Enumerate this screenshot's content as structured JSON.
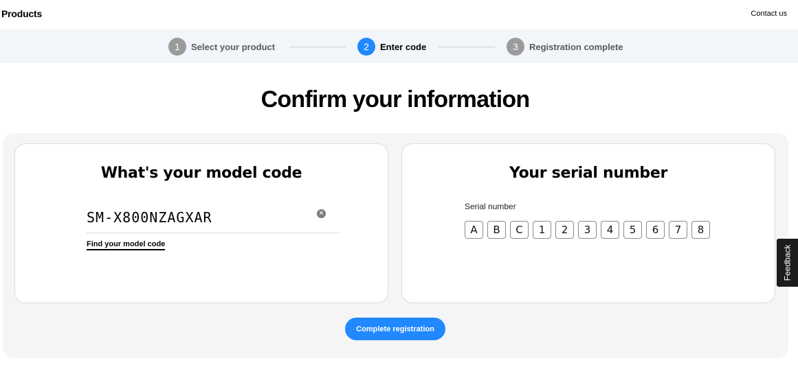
{
  "header": {
    "brand": "Products",
    "contact": "Contact us"
  },
  "stepper": {
    "steps": [
      {
        "number": "1",
        "label": "Select your product",
        "state": "done"
      },
      {
        "number": "2",
        "label": "Enter code",
        "state": "active"
      },
      {
        "number": "3",
        "label": "Registration complete",
        "state": "pending"
      }
    ]
  },
  "page": {
    "title": "Confirm your information"
  },
  "model_card": {
    "title": "What's your model code",
    "value": "SM-X800NZAGXAR",
    "clear_icon": "clear-icon",
    "find_link": "Find your model code"
  },
  "serial_card": {
    "title": "Your serial number",
    "label": "Serial number",
    "chars": [
      "A",
      "B",
      "C",
      "1",
      "2",
      "3",
      "4",
      "5",
      "6",
      "7",
      "8"
    ]
  },
  "actions": {
    "submit": "Complete registration",
    "feedback": "Feedback"
  },
  "colors": {
    "accent": "#2189ff",
    "step_inactive": "#9b9b9b",
    "stepper_bg": "#f2f5f9",
    "panel_bg": "#f5f5f5"
  }
}
